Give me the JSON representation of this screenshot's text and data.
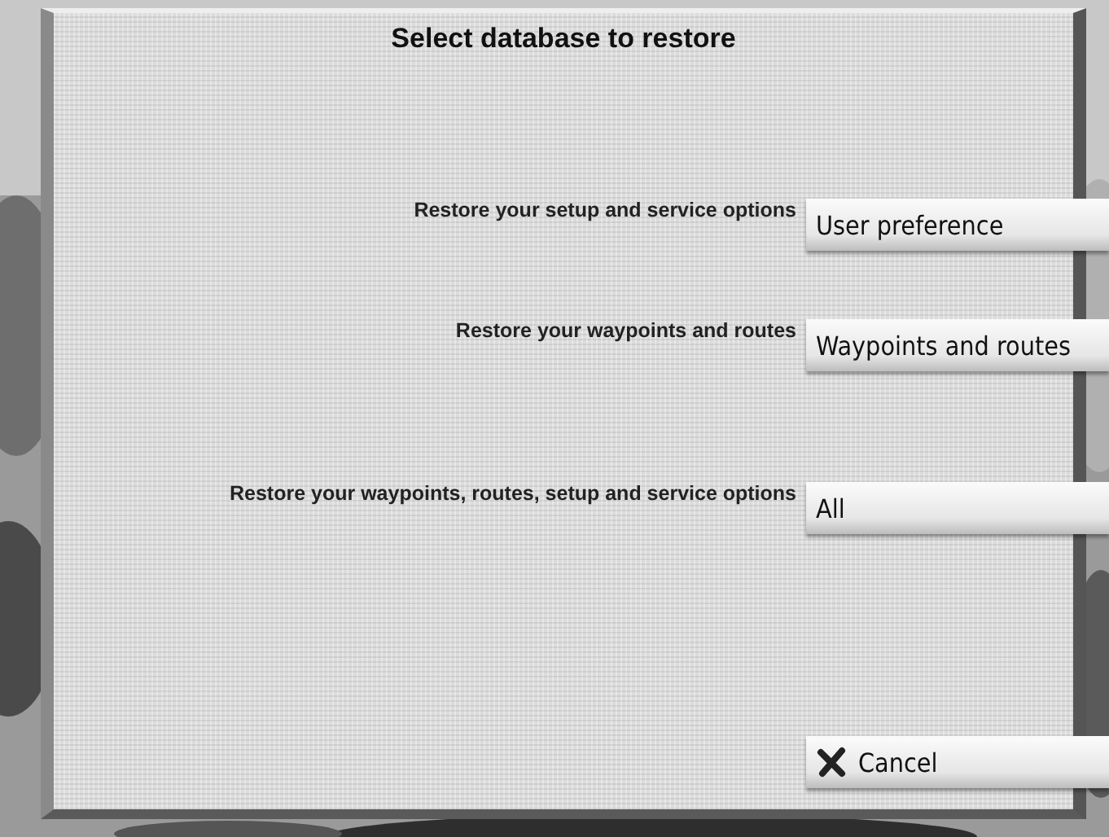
{
  "dialog": {
    "title": "Select database to restore"
  },
  "options": [
    {
      "label": "Restore your setup and service options",
      "button": "User preference"
    },
    {
      "label": "Restore your waypoints and routes",
      "button": "Waypoints and routes"
    },
    {
      "label": "Restore your waypoints, routes, setup and service options",
      "button": "All"
    }
  ],
  "cancel": {
    "label": "Cancel"
  }
}
